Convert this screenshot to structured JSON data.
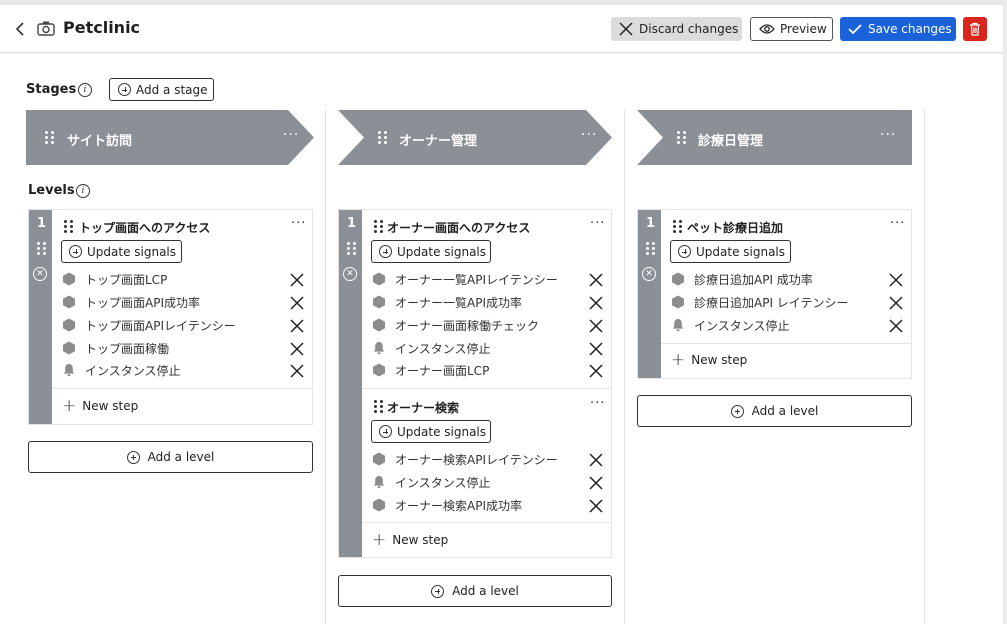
{
  "header": {
    "title": "Petclinic",
    "discard_label": "Discard changes",
    "preview_label": "Preview",
    "save_label": "Save changes"
  },
  "stages_label": "Stages",
  "add_stage_label": "Add a stage",
  "levels_label": "Levels",
  "columns": [
    {
      "stage_name": "サイト訪問",
      "levels": [
        {
          "number": "1",
          "sections": [
            {
              "title": "トップ画面へのアクセス",
              "update_label": "Update signals",
              "steps": [
                {
                  "label": "トップ画面LCP",
                  "icon": "hexagon-icon"
                },
                {
                  "label": "トップ画面API成功率",
                  "icon": "hexagon-icon"
                },
                {
                  "label": "トップ画面APIレイテンシー",
                  "icon": "hexagon-icon"
                },
                {
                  "label": "トップ画面稼働",
                  "icon": "hexagon-icon"
                },
                {
                  "label": "インスタンス停止",
                  "icon": "bell-icon"
                }
              ]
            }
          ],
          "new_step_label": "New step"
        }
      ],
      "add_level_label": "Add a level"
    },
    {
      "stage_name": "オーナー管理",
      "levels": [
        {
          "number": "1",
          "sections": [
            {
              "title": "オーナー画面へのアクセス",
              "update_label": "Update signals",
              "steps": [
                {
                  "label": "オーナー一覧APIレイテンシー",
                  "icon": "hexagon-icon"
                },
                {
                  "label": "オーナー一覧API成功率",
                  "icon": "hexagon-icon"
                },
                {
                  "label": "オーナー画面稼働チェック",
                  "icon": "hexagon-icon"
                },
                {
                  "label": "インスタンス停止",
                  "icon": "bell-icon"
                },
                {
                  "label": "オーナー画面LCP",
                  "icon": "hexagon-icon"
                }
              ]
            },
            {
              "title": "オーナー検索",
              "update_label": "Update signals",
              "steps": [
                {
                  "label": "オーナー検索APIレイテンシー",
                  "icon": "hexagon-icon"
                },
                {
                  "label": "インスタンス停止",
                  "icon": "bell-icon"
                },
                {
                  "label": "オーナー検索API成功率",
                  "icon": "hexagon-icon"
                }
              ]
            }
          ],
          "new_step_label": "New step"
        }
      ],
      "add_level_label": "Add a level"
    },
    {
      "stage_name": "診療日管理",
      "levels": [
        {
          "number": "1",
          "sections": [
            {
              "title": "ペット診療日追加",
              "update_label": "Update signals",
              "steps": [
                {
                  "label": "診療日追加API 成功率",
                  "icon": "hexagon-icon"
                },
                {
                  "label": "診療日追加API レイテンシー",
                  "icon": "hexagon-icon"
                },
                {
                  "label": "インスタンス停止",
                  "icon": "bell-icon"
                }
              ]
            }
          ],
          "new_step_label": "New step"
        }
      ],
      "add_level_label": "Add a level"
    }
  ],
  "colors": {
    "stage_fill": "#8b9096",
    "primary": "#1a62d9",
    "danger": "#d9251c",
    "discard_bg": "#dcdcdc"
  }
}
